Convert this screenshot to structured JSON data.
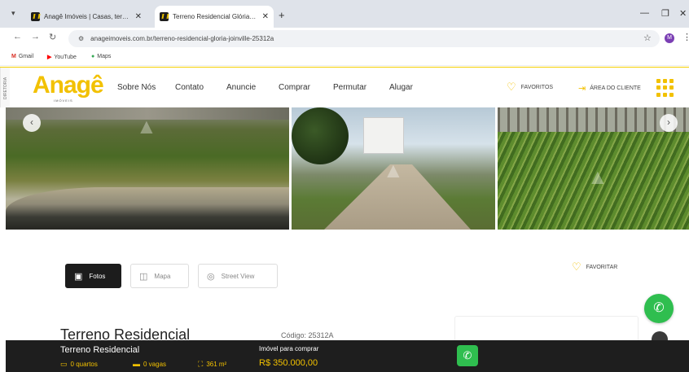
{
  "browser": {
    "tabs": [
      {
        "title": "Anagê Imóveis | Casas, terrenos"
      },
      {
        "title": "Terreno Residencial Glória Joinville"
      }
    ],
    "url": "anageimoveis.com.br/terreno-residencial-gloria-joinville-25312a",
    "bookmarks": [
      {
        "label": "Gmail",
        "icon": "gmail-icon"
      },
      {
        "label": "YouTube",
        "icon": "youtube-icon"
      },
      {
        "label": "Maps",
        "icon": "maps-icon"
      }
    ],
    "profile_initial": "M"
  },
  "header": {
    "side_tag": "DIRETORIA",
    "logo_text": "Anagê",
    "logo_sub": "IMÓVEIS",
    "menu": [
      "Sobre Nós",
      "Contato",
      "Anuncie",
      "Comprar",
      "Permutar",
      "Alugar"
    ],
    "favorites_label": "FAVORITOS",
    "client_area_label": "ÁREA DO CLIENTE"
  },
  "view_tabs": {
    "photos": "Fotos",
    "map": "Mapa",
    "street": "Street View"
  },
  "favoritar_label": "FAVORITAR",
  "listing": {
    "title": "Terreno Residencial",
    "code": "Código: 25312A"
  },
  "bottom_bar": {
    "title": "Terreno Residencial",
    "bedrooms": "0 quartos",
    "parking": "0 vagas",
    "area": "361 m²",
    "buy_label": "Imóvel para comprar",
    "price": "R$ 350.000,00"
  },
  "colors": {
    "brand_yellow": "#f2c100",
    "whatsapp_green": "#2fbe4f",
    "bar_dark": "#1e1e1e"
  }
}
